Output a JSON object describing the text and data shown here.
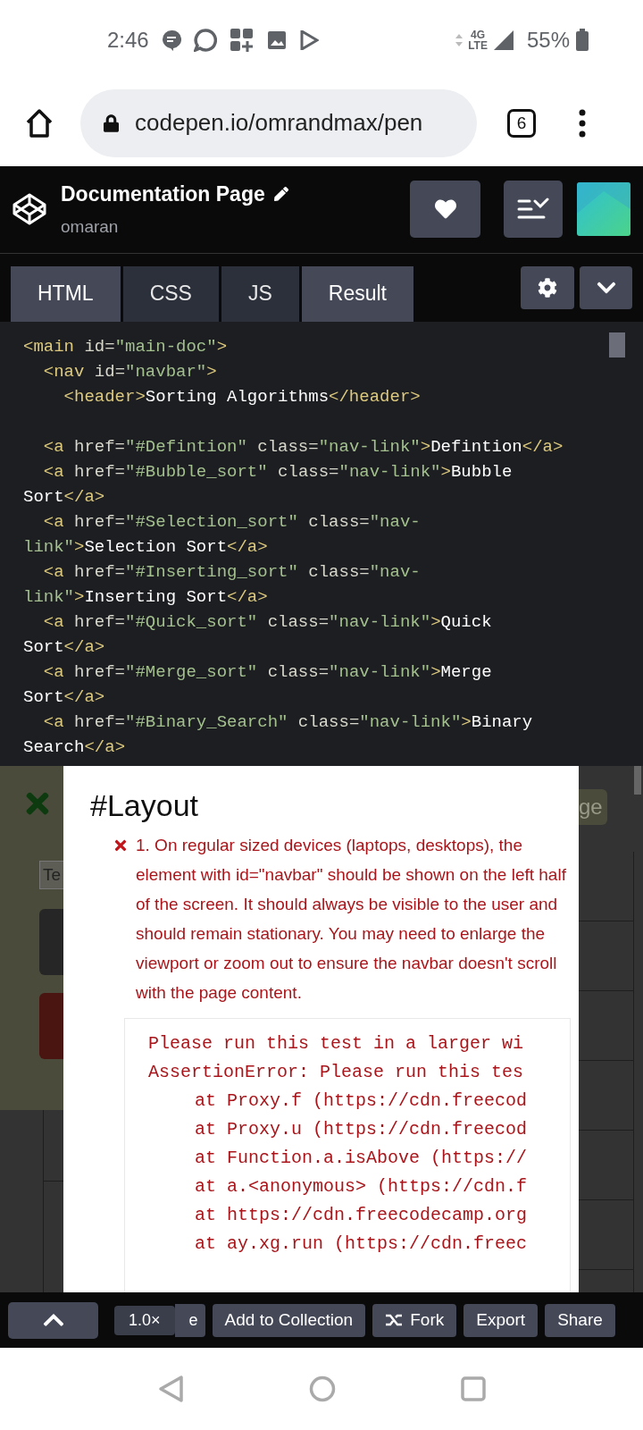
{
  "status_bar": {
    "time": "2:46",
    "network": "4G",
    "network_sub": "LTE",
    "battery": "55%"
  },
  "browser": {
    "url": "codepen.io/omrandmax/pen",
    "tab_count": "6"
  },
  "pen": {
    "title": "Documentation Page",
    "author": "omaran"
  },
  "tabs": [
    {
      "label": "HTML",
      "selected": true
    },
    {
      "label": "CSS",
      "selected": false
    },
    {
      "label": "JS",
      "selected": false
    },
    {
      "label": "Result",
      "selected": true
    }
  ],
  "code_lines": [
    {
      "kind": "code",
      "tokens": [
        {
          "kind": "tag",
          "text": "<main "
        },
        {
          "kind": "attr",
          "text": "id="
        },
        {
          "kind": "str",
          "text": "\"main-doc\""
        },
        {
          "kind": "tag",
          "text": ">"
        }
      ]
    },
    {
      "kind": "code",
      "tokens": [
        {
          "kind": "tag",
          "text": "  <nav "
        },
        {
          "kind": "attr",
          "text": "id="
        },
        {
          "kind": "str",
          "text": "\"navbar\""
        },
        {
          "kind": "tag",
          "text": ">"
        }
      ]
    },
    {
      "kind": "code",
      "tokens": [
        {
          "kind": "tag",
          "text": "    <header>"
        },
        {
          "kind": "text",
          "text": "Sorting Algorithms"
        },
        {
          "kind": "tag",
          "text": "</header>"
        }
      ]
    },
    {
      "kind": "blank"
    },
    {
      "kind": "code",
      "tokens": [
        {
          "kind": "tag",
          "text": "  <a "
        },
        {
          "kind": "attr",
          "text": "href="
        },
        {
          "kind": "str",
          "text": "\"#Defintion\""
        },
        {
          "kind": "attr",
          "text": " class="
        },
        {
          "kind": "str",
          "text": "\"nav-link\""
        },
        {
          "kind": "tag",
          "text": ">"
        },
        {
          "kind": "text",
          "text": "Defintion"
        },
        {
          "kind": "tag",
          "text": "</a>"
        }
      ]
    },
    {
      "kind": "code",
      "tokens": [
        {
          "kind": "tag",
          "text": "  <a "
        },
        {
          "kind": "attr",
          "text": "href="
        },
        {
          "kind": "str",
          "text": "\"#Bubble_sort\""
        },
        {
          "kind": "attr",
          "text": " class="
        },
        {
          "kind": "str",
          "text": "\"nav-link\""
        },
        {
          "kind": "tag",
          "text": ">"
        },
        {
          "kind": "text",
          "text": "Bubble"
        }
      ]
    },
    {
      "kind": "code",
      "tokens": [
        {
          "kind": "text",
          "text": "Sort"
        },
        {
          "kind": "tag",
          "text": "</a>"
        }
      ]
    },
    {
      "kind": "code",
      "tokens": [
        {
          "kind": "tag",
          "text": "  <a "
        },
        {
          "kind": "attr",
          "text": "href="
        },
        {
          "kind": "str",
          "text": "\"#Selection_sort\""
        },
        {
          "kind": "attr",
          "text": " class="
        },
        {
          "kind": "str",
          "text": "\"nav-"
        }
      ]
    },
    {
      "kind": "code",
      "tokens": [
        {
          "kind": "str",
          "text": "link\""
        },
        {
          "kind": "tag",
          "text": ">"
        },
        {
          "kind": "text",
          "text": "Selection Sort"
        },
        {
          "kind": "tag",
          "text": "</a>"
        }
      ]
    },
    {
      "kind": "code",
      "tokens": [
        {
          "kind": "tag",
          "text": "  <a "
        },
        {
          "kind": "attr",
          "text": "href="
        },
        {
          "kind": "str",
          "text": "\"#Inserting_sort\""
        },
        {
          "kind": "attr",
          "text": " class="
        },
        {
          "kind": "str",
          "text": "\"nav-"
        }
      ]
    },
    {
      "kind": "code",
      "tokens": [
        {
          "kind": "str",
          "text": "link\""
        },
        {
          "kind": "tag",
          "text": ">"
        },
        {
          "kind": "text",
          "text": "Inserting Sort"
        },
        {
          "kind": "tag",
          "text": "</a>"
        }
      ]
    },
    {
      "kind": "code",
      "tokens": [
        {
          "kind": "tag",
          "text": "  <a "
        },
        {
          "kind": "attr",
          "text": "href="
        },
        {
          "kind": "str",
          "text": "\"#Quick_sort\""
        },
        {
          "kind": "attr",
          "text": " class="
        },
        {
          "kind": "str",
          "text": "\"nav-link\""
        },
        {
          "kind": "tag",
          "text": ">"
        },
        {
          "kind": "text",
          "text": "Quick"
        }
      ]
    },
    {
      "kind": "code",
      "tokens": [
        {
          "kind": "text",
          "text": "Sort"
        },
        {
          "kind": "tag",
          "text": "</a>"
        }
      ]
    },
    {
      "kind": "code",
      "tokens": [
        {
          "kind": "tag",
          "text": "  <a "
        },
        {
          "kind": "attr",
          "text": "href="
        },
        {
          "kind": "str",
          "text": "\"#Merge_sort\""
        },
        {
          "kind": "attr",
          "text": " class="
        },
        {
          "kind": "str",
          "text": "\"nav-link\""
        },
        {
          "kind": "tag",
          "text": ">"
        },
        {
          "kind": "text",
          "text": "Merge"
        }
      ]
    },
    {
      "kind": "code",
      "tokens": [
        {
          "kind": "text",
          "text": "Sort"
        },
        {
          "kind": "tag",
          "text": "</a>"
        }
      ]
    },
    {
      "kind": "code",
      "tokens": [
        {
          "kind": "tag",
          "text": "  <a "
        },
        {
          "kind": "attr",
          "text": "href="
        },
        {
          "kind": "str",
          "text": "\"#Binary_Search\""
        },
        {
          "kind": "attr",
          "text": " class="
        },
        {
          "kind": "str",
          "text": "\"nav-link\""
        },
        {
          "kind": "tag",
          "text": ">"
        },
        {
          "kind": "text",
          "text": "Binary"
        }
      ]
    },
    {
      "kind": "code",
      "tokens": [
        {
          "kind": "text",
          "text": "Search"
        },
        {
          "kind": "tag",
          "text": "</a>"
        }
      ]
    }
  ],
  "backdrop": {
    "field_value": "Te",
    "button_text": "ge"
  },
  "test_modal": {
    "heading": "#Layout",
    "failure": {
      "passed": false,
      "text": "1. On regular sized devices (laptops, desktops), the element with id=\"navbar\" should be shown on the left half of the screen. It should always be visible to the user and should remain stationary. You may need to enlarge the viewport or zoom out to ensure the navbar doesn't scroll with the page content."
    },
    "error_lines": [
      {
        "kind": "message",
        "text": "Please run this test in a larger wi"
      },
      {
        "kind": "message",
        "text": "AssertionError: Please run this tes"
      },
      {
        "kind": "frame",
        "text": "at Proxy.f (https://cdn.freecod"
      },
      {
        "kind": "frame",
        "text": "at Proxy.u (https://cdn.freecod"
      },
      {
        "kind": "frame",
        "text": "at Function.a.isAbove (https://"
      },
      {
        "kind": "frame",
        "text": "at a.<anonymous> (https://cdn.f"
      },
      {
        "kind": "frame",
        "text": "at https://cdn.freecodecamp.org"
      },
      {
        "kind": "frame",
        "text": "at ay.xg.run (https://cdn.freec"
      }
    ]
  },
  "bottom_bar": {
    "zoom": "1.0×",
    "hidden_button": "e",
    "buttons": [
      {
        "label": "Add to Collection",
        "kind": "plain"
      },
      {
        "label": "Fork",
        "kind": "fork"
      },
      {
        "label": "Export",
        "kind": "plain"
      },
      {
        "label": "Share",
        "kind": "plain"
      }
    ]
  }
}
